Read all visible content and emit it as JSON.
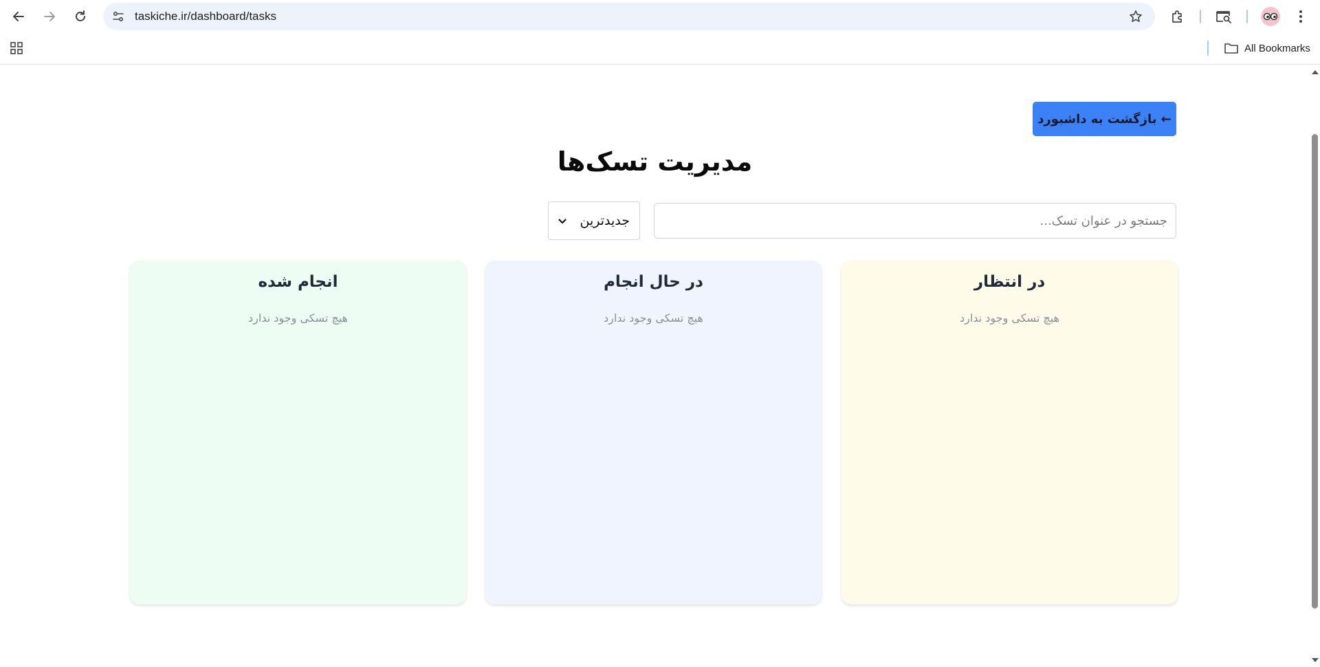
{
  "browser": {
    "url": "taskiche.ir/dashboard/tasks",
    "bookmarks_label": "All Bookmarks"
  },
  "page": {
    "back_button_label": "← بازگشت به داشبورد",
    "title": "مدیریت تسک‌ها",
    "search": {
      "placeholder": "جستجو در عنوان تسک...",
      "value": ""
    },
    "sort": {
      "selected": "جدیدترین"
    },
    "columns": [
      {
        "title": "در انتظار",
        "empty_text": "هیچ تسکی وجود ندارد",
        "color": "#fefbe8"
      },
      {
        "title": "در حال انجام",
        "empty_text": "هیچ تسکی وجود ندارد",
        "color": "#eff4fe"
      },
      {
        "title": "انجام شده",
        "empty_text": "هیچ تسکی وجود ندارد",
        "color": "#eefdf4"
      }
    ]
  },
  "colors": {
    "accent": "#3b82f6",
    "omnibox": "#eef2fb"
  },
  "icons": [
    "back-arrow-icon",
    "forward-arrow-icon",
    "reload-icon",
    "site-info-icon",
    "star-icon",
    "extensions-icon",
    "tab-search-icon",
    "profile-avatar-icon",
    "kebab-menu-icon",
    "apps-grid-icon",
    "folder-icon",
    "chevron-down-icon"
  ]
}
